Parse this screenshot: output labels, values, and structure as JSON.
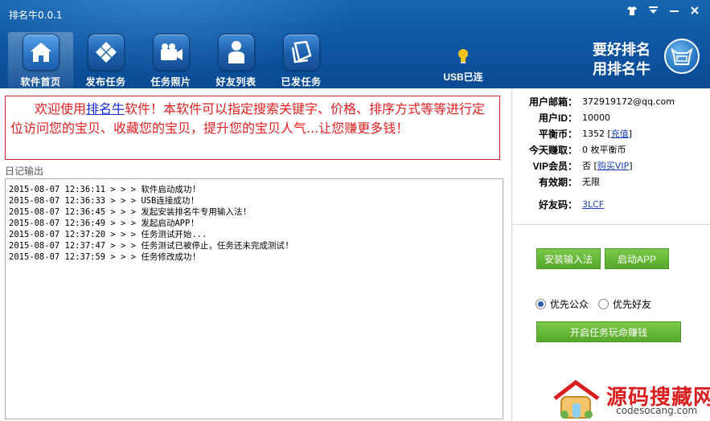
{
  "window": {
    "title": "排名牛0.0.1",
    "controls": [
      "shirt-icon",
      "menu-icon",
      "minimize-icon",
      "close-icon"
    ]
  },
  "nav": {
    "items": [
      {
        "label": "软件首页",
        "icon": "home-icon",
        "active": true
      },
      {
        "label": "发布任务",
        "icon": "diamond-grid-icon",
        "active": false
      },
      {
        "label": "任务照片",
        "icon": "camera-icon",
        "active": false
      },
      {
        "label": "好友列表",
        "icon": "user-icon",
        "active": false
      },
      {
        "label": "已发任务",
        "icon": "document-icon",
        "active": false
      }
    ]
  },
  "usb": {
    "label": "USB已连",
    "icon": "lightbulb-icon"
  },
  "brand": {
    "slogan_line1": "要好排名",
    "slogan_line2": "用排名牛"
  },
  "welcome": {
    "before_link": "欢迎使用",
    "link": "排名牛",
    "after_link": "软件！本软件可以指定搜索关键字、价格、排序方式等等进行定位访问您的宝贝、收藏您的宝贝，提升您的宝贝人气...让您赚更多钱！"
  },
  "log": {
    "title": "日记输出",
    "lines": [
      "2015-08-07 12:36:11 > > > 软件启动成功!",
      "2015-08-07 12:36:33 > > > USB连接成功!",
      "2015-08-07 12:36:45 > > > 发起安装排名牛专用输入法!",
      "2015-08-07 12:36:49 > > > 发起启动APP!",
      "2015-08-07 12:37:20 > > > 任务测试开始...",
      "2015-08-07 12:37:47 > > > 任务测试已被停止，任务还未完成测试!",
      "2015-08-07 12:37:59 > > > 任务修改成功!"
    ]
  },
  "account": {
    "email_label": "用户邮箱：",
    "email": "372919172@qq.com",
    "id_label": "用户ID：",
    "id": "10000",
    "coins_label": "平衡币：",
    "coins": "1352",
    "recharge": "充值",
    "today_label": "今天赚取：",
    "today": "0 枚平衡币",
    "vip_label": "VIP会员：",
    "vip": "否",
    "buy_vip": "购买VIP",
    "expiry_label": "有效期：",
    "expiry": "无限",
    "friend_code_label": "好友码：",
    "friend_code": "3LCF"
  },
  "actions": {
    "install_ime": "安装输入法",
    "launch_app": "启动APP",
    "priority_public": "优先公众",
    "priority_friends": "优先好友",
    "start_tasks": "开启任务玩命赚钱"
  },
  "watermark": {
    "cn": "源码搜藏网",
    "en": "codesocang.com"
  },
  "colors": {
    "header": "#0f57a3",
    "welcome_text": "#e02020",
    "button_green": "#5cb030",
    "link": "#1a2fd6"
  }
}
